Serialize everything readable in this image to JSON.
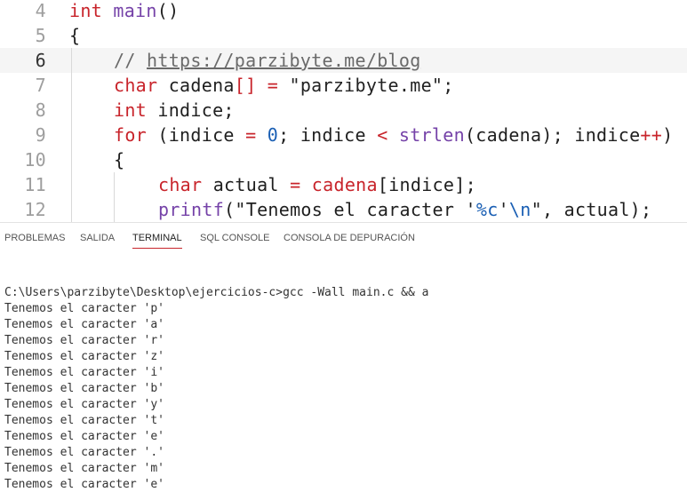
{
  "editor": {
    "lines": [
      {
        "number": "4",
        "current": false,
        "indent": 0,
        "tokens": [
          {
            "t": "int",
            "c": "kw"
          },
          {
            "t": " ",
            "c": "plain"
          },
          {
            "t": "main",
            "c": "fn"
          },
          {
            "t": "()",
            "c": "plain"
          }
        ]
      },
      {
        "number": "5",
        "current": false,
        "indent": 0,
        "tokens": [
          {
            "t": "{",
            "c": "plain"
          }
        ]
      },
      {
        "number": "6",
        "current": true,
        "indent": 1,
        "tokens": [
          {
            "t": "// ",
            "c": "comment"
          },
          {
            "t": "https://parzibyte.me/blog",
            "c": "link"
          }
        ]
      },
      {
        "number": "7",
        "current": false,
        "indent": 1,
        "tokens": [
          {
            "t": "char",
            "c": "kw"
          },
          {
            "t": " cadena",
            "c": "plain"
          },
          {
            "t": "[]",
            "c": "op"
          },
          {
            "t": " ",
            "c": "plain"
          },
          {
            "t": "=",
            "c": "op"
          },
          {
            "t": " \"parzibyte.me\";",
            "c": "str"
          }
        ]
      },
      {
        "number": "8",
        "current": false,
        "indent": 1,
        "tokens": [
          {
            "t": "int",
            "c": "kw"
          },
          {
            "t": " indice;",
            "c": "plain"
          }
        ]
      },
      {
        "number": "9",
        "current": false,
        "indent": 1,
        "tokens": [
          {
            "t": "for",
            "c": "kw"
          },
          {
            "t": " (indice ",
            "c": "plain"
          },
          {
            "t": "=",
            "c": "op"
          },
          {
            "t": " ",
            "c": "plain"
          },
          {
            "t": "0",
            "c": "num"
          },
          {
            "t": "; indice ",
            "c": "plain"
          },
          {
            "t": "<",
            "c": "op"
          },
          {
            "t": " ",
            "c": "plain"
          },
          {
            "t": "strlen",
            "c": "fn"
          },
          {
            "t": "(cadena); indice",
            "c": "plain"
          },
          {
            "t": "++",
            "c": "op"
          },
          {
            "t": ")",
            "c": "plain"
          }
        ]
      },
      {
        "number": "10",
        "current": false,
        "indent": 1,
        "tokens": [
          {
            "t": "{",
            "c": "plain"
          }
        ]
      },
      {
        "number": "11",
        "current": false,
        "indent": 2,
        "tokens": [
          {
            "t": "char",
            "c": "kw"
          },
          {
            "t": " actual ",
            "c": "plain"
          },
          {
            "t": "=",
            "c": "op"
          },
          {
            "t": " ",
            "c": "plain"
          },
          {
            "t": "cadena",
            "c": "kw"
          },
          {
            "t": "[indice];",
            "c": "plain"
          }
        ]
      },
      {
        "number": "12",
        "current": false,
        "indent": 2,
        "tokens": [
          {
            "t": "printf",
            "c": "fn"
          },
          {
            "t": "(\"Tenemos el caracter '",
            "c": "plain"
          },
          {
            "t": "%c",
            "c": "esc"
          },
          {
            "t": "'",
            "c": "plain"
          },
          {
            "t": "\\n",
            "c": "esc"
          },
          {
            "t": "\", actual);",
            "c": "plain"
          }
        ]
      }
    ]
  },
  "panel": {
    "tabs": [
      {
        "label": "PROBLEMAS",
        "active": false
      },
      {
        "label": "SALIDA",
        "active": false
      },
      {
        "label": "TERMINAL",
        "active": true
      },
      {
        "label": "SQL CONSOLE",
        "active": false
      },
      {
        "label": "CONSOLA DE DEPURACIÓN",
        "active": false
      }
    ],
    "accent_color": "#c8242b"
  },
  "terminal": {
    "lines": [
      "C:\\Users\\parzibyte\\Desktop\\ejercicios-c>gcc -Wall main.c && a",
      "Tenemos el caracter 'p'",
      "Tenemos el caracter 'a'",
      "Tenemos el caracter 'r'",
      "Tenemos el caracter 'z'",
      "Tenemos el caracter 'i'",
      "Tenemos el caracter 'b'",
      "Tenemos el caracter 'y'",
      "Tenemos el caracter 't'",
      "Tenemos el caracter 'e'",
      "Tenemos el caracter '.'",
      "Tenemos el caracter 'm'",
      "Tenemos el caracter 'e'"
    ]
  }
}
